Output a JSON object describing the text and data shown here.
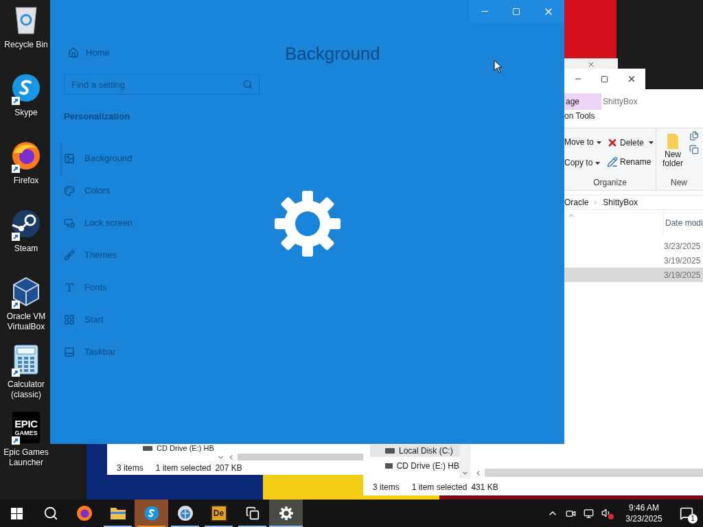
{
  "desktop_icons": [
    {
      "label": "Recycle Bin",
      "kind": "bin",
      "shortcut": false
    },
    {
      "label": "Skype",
      "kind": "chat",
      "shortcut": true
    },
    {
      "label": "Firefox",
      "kind": "browser",
      "shortcut": true
    },
    {
      "label": "Steam",
      "kind": "game",
      "shortcut": true
    },
    {
      "label": "Oracle VM VirtualBox",
      "kind": "vm",
      "shortcut": true
    },
    {
      "label": "Calculator (classic)",
      "kind": "calculator",
      "shortcut": true
    },
    {
      "label": "Epic Games Launcher",
      "kind": "launcher",
      "shortcut": true,
      "logo_text": [
        "EPIC",
        "GAMES"
      ]
    }
  ],
  "explorer_left": {
    "nav_item": "CD Drive (E:) HB",
    "status": [
      "3 items",
      "1 item selected",
      "207 KB"
    ]
  },
  "explorer_right": {
    "ribbon_tabs": [
      {
        "label": "age",
        "selected": true
      },
      {
        "label": "ShittyBox",
        "selected": false
      }
    ],
    "contextual_group": "on Tools",
    "organize": {
      "move_to": "Move to",
      "copy_to": "Copy to",
      "delete": "Delete",
      "rename": "Rename",
      "label": "Organize"
    },
    "new_group": {
      "new_folder": "New folder",
      "label": "New"
    },
    "breadcrumb": [
      "Oracle",
      "ShittyBox"
    ],
    "column": "Date modi",
    "rows": [
      {
        "date": "3/23/2025",
        "selected": false
      },
      {
        "date": "3/19/2025",
        "selected": false
      },
      {
        "date": "3/19/2025",
        "selected": true
      }
    ],
    "nav_items": [
      {
        "label": "Local Disk (C:)",
        "selected": true
      },
      {
        "label": "CD Drive (E:) HB",
        "selected": false
      }
    ],
    "status": [
      "3 items",
      "1 item selected",
      "431 KB"
    ]
  },
  "settings_window": {
    "page_title": "Background",
    "home": "Home",
    "search": {
      "placeholder": "Find a setting"
    },
    "section": "Personalization",
    "nav_items": [
      {
        "label": "Background",
        "kind": "picture",
        "selected": true
      },
      {
        "label": "Colors",
        "kind": "palette",
        "selected": false
      },
      {
        "label": "Lock screen",
        "kind": "lock",
        "selected": false
      },
      {
        "label": "Themes",
        "kind": "brush",
        "selected": false
      },
      {
        "label": "Fonts",
        "kind": "font",
        "selected": false
      },
      {
        "label": "Start",
        "kind": "start",
        "selected": false
      },
      {
        "label": "Taskbar",
        "kind": "taskbar",
        "selected": false
      }
    ]
  },
  "taskbar": {
    "items": [
      {
        "kind": "start",
        "running": false,
        "flashing": false,
        "active": false
      },
      {
        "kind": "search",
        "running": false,
        "flashing": false,
        "active": false
      },
      {
        "kind": "firefox",
        "running": false,
        "flashing": false,
        "active": false
      },
      {
        "kind": "folder",
        "running": true,
        "flashing": false,
        "active": false
      },
      {
        "kind": "chat",
        "running": true,
        "flashing": true,
        "active": false
      },
      {
        "kind": "globe",
        "running": true,
        "flashing": false,
        "active": false
      },
      {
        "kind": "de",
        "running": true,
        "flashing": false,
        "active": false,
        "app_label": "De"
      },
      {
        "kind": "taskview",
        "running": true,
        "flashing": false,
        "active": false
      },
      {
        "kind": "gear",
        "running": true,
        "flashing": false,
        "active": true
      }
    ],
    "time": "9:46 AM",
    "date": "3/23/2025",
    "notifications": "1"
  }
}
